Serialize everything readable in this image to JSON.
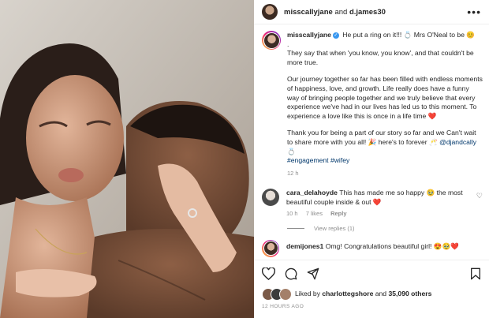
{
  "post": {
    "header": {
      "user1": "misscallyjane",
      "joiner": "and",
      "user2": "d.james30"
    },
    "caption": {
      "username": "misscallyjane",
      "line1": "He put a ring on it!!! 💍 Mrs O'Neal to be 😊",
      "dot": ".",
      "p1": "They say that when 'you know, you know', and that couldn't be more true.",
      "p2": "Our journey together so far has been filled with endless moments of happiness, love, and growth. Life really does have a funny way of bringing people together and we truly believe that every experience we've had in our lives has led us to this moment. To experience a love like this is once in a life time ❤️",
      "p3": "Thank you for being a part of our story so far and we Can't wait to share more with you all! 🎉 here's to forever 🥂",
      "p3_mention": "@djandcally",
      "p3_tail": "💍",
      "tags": "#engagement #wifey",
      "time": "12 h"
    },
    "comments": [
      {
        "user": "cara_delahoyde",
        "text": "This has made me so happy 🥹 the most beautiful couple inside & out ❤️",
        "time": "10 h",
        "likes": "7 likes",
        "reply": "Reply",
        "view_replies": "View replies (1)"
      },
      {
        "user": "demijones1",
        "text": "Omg! Congratulations beautiful girl! 😍🥹❤️"
      }
    ],
    "liked": {
      "prefix": "Liked by",
      "user": "charlottegshore",
      "and": "and",
      "count": "35,090 others"
    },
    "timestamp": "12 HOURS AGO"
  },
  "colors": {
    "accent": "#3897f0",
    "muted": "#8e8e8e",
    "link": "#00376b"
  },
  "icons": [
    "more-icon",
    "heart-icon",
    "comment-icon",
    "share-icon",
    "bookmark-icon"
  ]
}
